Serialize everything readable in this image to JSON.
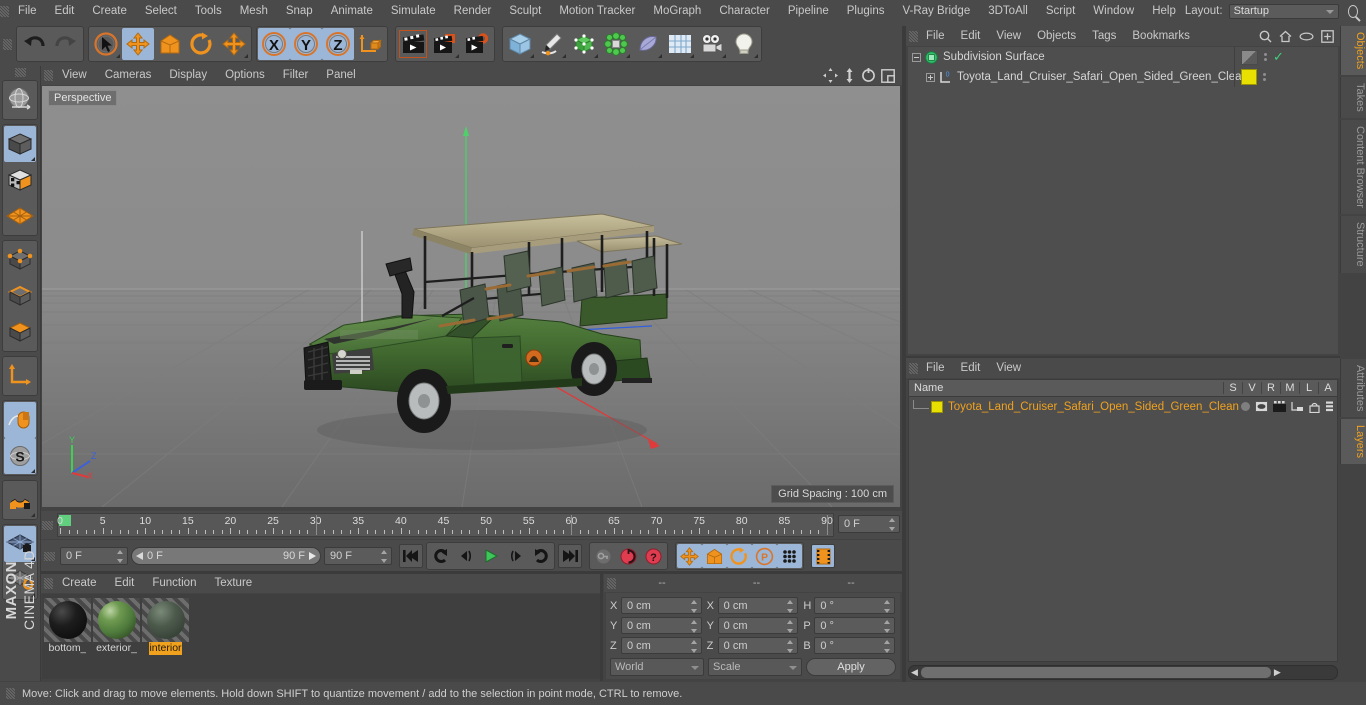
{
  "app": {
    "title": "MAXON CINEMA 4D",
    "brand_line1": "MAXON",
    "brand_line2": "CINEMA 4D"
  },
  "top_menu": {
    "items": [
      "File",
      "Edit",
      "Create",
      "Select",
      "Tools",
      "Mesh",
      "Snap",
      "Animate",
      "Simulate",
      "Render",
      "Sculpt",
      "Motion Tracker",
      "MoGraph",
      "Character",
      "Pipeline",
      "Plugins",
      "V-Ray Bridge",
      "3DToAll",
      "Script",
      "Window",
      "Help"
    ],
    "layout_label": "Layout:",
    "layout_value": "Startup",
    "search_icon": "search-icon"
  },
  "toolbar": {
    "groups": [
      {
        "name": "history",
        "buttons": [
          {
            "name": "undo-button",
            "icon": "undo-arrow-icon",
            "active": false,
            "enabled": true
          },
          {
            "name": "redo-button",
            "icon": "redo-arrow-icon",
            "active": false,
            "enabled": false
          }
        ]
      },
      {
        "name": "transform-tools",
        "buttons": [
          {
            "name": "live-selection-tool",
            "icon": "cursor-circle-icon",
            "active": false,
            "corner": true
          },
          {
            "name": "move-tool",
            "icon": "move-cross-icon",
            "active": true
          },
          {
            "name": "scale-tool",
            "icon": "scale-box-icon",
            "active": false
          },
          {
            "name": "rotate-tool",
            "icon": "rotate-circle-icon",
            "active": false
          },
          {
            "name": "free-move-tool",
            "icon": "move-cross-icon",
            "active": false,
            "corner": true
          }
        ]
      },
      {
        "name": "axis-locks",
        "buttons": [
          {
            "name": "lock-x-axis-button",
            "icon": "x-axis-icon",
            "label": "X",
            "active": true
          },
          {
            "name": "lock-y-axis-button",
            "icon": "y-axis-icon",
            "label": "Y",
            "active": true
          },
          {
            "name": "lock-z-axis-button",
            "icon": "z-axis-icon",
            "label": "Z",
            "active": true
          },
          {
            "name": "world-object-coordinate-button",
            "icon": "world-axis-cube-icon",
            "active": false
          }
        ]
      },
      {
        "name": "render-tools",
        "buttons": [
          {
            "name": "render-view-button",
            "icon": "clapper-icon",
            "active": false,
            "selected_outline": true
          },
          {
            "name": "render-to-picture-viewer-button",
            "icon": "clapper-picture-icon",
            "active": false,
            "corner": true
          },
          {
            "name": "render-settings-button",
            "icon": "clapper-gear-icon",
            "active": false
          }
        ]
      },
      {
        "name": "create-objects",
        "buttons": [
          {
            "name": "add-cube-button",
            "icon": "cube-icon",
            "active": false,
            "corner": true
          },
          {
            "name": "add-spline-button",
            "icon": "pen-spline-icon",
            "active": false,
            "corner": true
          },
          {
            "name": "add-generator-button",
            "icon": "green-cube-generator-icon",
            "active": false,
            "corner": true
          },
          {
            "name": "add-mograph-button",
            "icon": "cloner-icon",
            "active": false,
            "corner": true
          },
          {
            "name": "add-deformer-button",
            "icon": "bend-deformer-icon",
            "active": false,
            "corner": true
          },
          {
            "name": "add-scene-object-button",
            "icon": "floor-grid-icon",
            "active": false,
            "corner": true
          },
          {
            "name": "add-camera-button",
            "icon": "camera-icon",
            "active": false,
            "corner": true
          },
          {
            "name": "add-light-button",
            "icon": "light-bulb-icon",
            "active": false,
            "corner": true
          }
        ]
      }
    ]
  },
  "left_toolbar": {
    "buttons": [
      {
        "name": "viewport-navigation-button",
        "icon": "globe-wire-icon",
        "active": false
      },
      {
        "name": "model-mode-button",
        "icon": "model-cube-icon",
        "active": true,
        "corner": true
      },
      {
        "name": "texture-mode-button",
        "icon": "texture-cube-icon",
        "active": false
      },
      {
        "name": "workplane-mode-button",
        "icon": "workplane-grid-icon",
        "active": false
      },
      {
        "name": "point-mode-button",
        "icon": "points-cube-icon",
        "active": false
      },
      {
        "name": "edge-mode-button",
        "icon": "edges-cube-icon",
        "active": false
      },
      {
        "name": "polygon-mode-button",
        "icon": "polygon-cube-icon",
        "active": false
      },
      {
        "name": "object-axis-mode-button",
        "icon": "axis-L-icon",
        "active": false
      },
      {
        "name": "viewport-solo-button",
        "icon": "mouse-icon",
        "active": true
      },
      {
        "name": "enable-axis-modification-button",
        "icon": "s-sphere-icon",
        "active": true,
        "corner": true
      },
      {
        "name": "snapping-button",
        "icon": "magnet-icon",
        "active": false,
        "corner": true
      },
      {
        "name": "workplane-lock-button",
        "icon": "grid-lock-icon",
        "active": true,
        "corner": true
      },
      {
        "name": "planar-workplane-button",
        "icon": "grid-rotate-icon",
        "active": false,
        "corner": true
      }
    ]
  },
  "viewport": {
    "menu": [
      "View",
      "Cameras",
      "Display",
      "Options",
      "Filter",
      "Panel"
    ],
    "view_label": "Perspective",
    "grid_spacing": "Grid Spacing : 100 cm",
    "panel_icons": [
      "move-view-icon",
      "pan-view-icon",
      "rotate-view-icon",
      "maximize-view-icon"
    ],
    "axis_gizmo": {
      "x": "X",
      "y": "Y",
      "z": "Z"
    }
  },
  "timeline": {
    "ticks": [
      "0",
      "5",
      "10",
      "15",
      "20",
      "25",
      "30",
      "35",
      "40",
      "45",
      "50",
      "55",
      "60",
      "65",
      "70",
      "75",
      "80",
      "85",
      "90"
    ],
    "end_field": "0 F",
    "current_frame_field": "0 F",
    "range_start": "0 F",
    "range_end": "90 F",
    "preview_end_field": "90 F",
    "transport": [
      {
        "name": "go-to-start-button",
        "icon": "skip-start-icon"
      },
      {
        "name": "play-backwards-button",
        "icon": "loop-back-icon"
      },
      {
        "name": "previous-frame-button",
        "icon": "step-back-icon"
      },
      {
        "name": "play-button",
        "icon": "play-icon",
        "accent": "#3ec759"
      },
      {
        "name": "next-frame-button",
        "icon": "step-forward-icon"
      },
      {
        "name": "play-forwards-button",
        "icon": "loop-forward-icon"
      },
      {
        "name": "go-to-end-button",
        "icon": "skip-end-icon"
      },
      {
        "name": "record-active-objects-button",
        "icon": "key-icon"
      },
      {
        "name": "autokeying-button",
        "icon": "record-red-icon",
        "accent": "#e03c50"
      },
      {
        "name": "keyframe-selection-button",
        "icon": "question-red-icon",
        "accent": "#e03c50"
      },
      {
        "name": "position-key-button",
        "icon": "move-cross-icon",
        "active": true
      },
      {
        "name": "scale-key-button",
        "icon": "scale-box-icon",
        "active": true
      },
      {
        "name": "rotation-key-button",
        "icon": "rotate-circle-icon",
        "active": true
      },
      {
        "name": "parameter-key-button",
        "icon": "p-circle-icon",
        "active": true
      },
      {
        "name": "point-level-animation-button",
        "icon": "pla-dots-icon",
        "active": true
      },
      {
        "name": "keyframe-preset-button",
        "icon": "filmstrip-icon",
        "active": true
      }
    ]
  },
  "material_manager": {
    "menu": [
      "Create",
      "Edit",
      "Function",
      "Texture"
    ],
    "materials": [
      {
        "name": "bottom_",
        "color": "#161616",
        "selected": false
      },
      {
        "name": "exterior_",
        "color": "#568046",
        "selected": false
      },
      {
        "name": "interior",
        "color": "#49564c",
        "selected": true
      }
    ]
  },
  "coordinate_manager": {
    "headers": [
      "--",
      "--",
      "--"
    ],
    "rows": [
      {
        "pos_label": "X",
        "pos_value": "0 cm",
        "size_label": "X",
        "size_value": "0 cm",
        "rot_label": "H",
        "rot_value": "0 °"
      },
      {
        "pos_label": "Y",
        "pos_value": "0 cm",
        "size_label": "Y",
        "size_value": "0 cm",
        "rot_label": "P",
        "rot_value": "0 °"
      },
      {
        "pos_label": "Z",
        "pos_value": "0 cm",
        "size_label": "Z",
        "size_value": "0 cm",
        "rot_label": "B",
        "rot_value": "0 °"
      }
    ],
    "system_select": "World",
    "mode_select": "Scale",
    "apply_label": "Apply"
  },
  "object_manager": {
    "menu": [
      "File",
      "Edit",
      "View",
      "Objects",
      "Tags",
      "Bookmarks"
    ],
    "right_icons": [
      "search-icon",
      "home-icon",
      "eye-icon",
      "add-layer-icon"
    ],
    "rows": [
      {
        "name": "Subdivision Surface",
        "icon": "subdivision-surface-icon",
        "indent": 0,
        "tag_color": "#8a8a8a",
        "has_check": true,
        "expanded": true
      },
      {
        "name": "Toyota_Land_Cruiser_Safari_Open_Sided_Green_Clean",
        "icon": "polygon-object-icon",
        "indent": 1,
        "tag_color": "#e8e000",
        "has_check": false,
        "expanded": false
      }
    ]
  },
  "layer_manager": {
    "menu": [
      "File",
      "Edit",
      "View"
    ],
    "columns": [
      "Name",
      "S",
      "V",
      "R",
      "M",
      "L",
      "A"
    ],
    "rows": [
      {
        "name": "Toyota_Land_Cruiser_Safari_Open_Sided_Green_Clean",
        "color": "#e8e000"
      }
    ]
  },
  "right_tabs": {
    "upper": [
      {
        "label": "Objects",
        "active": true
      },
      {
        "label": "Takes",
        "active": false
      },
      {
        "label": "Content Browser",
        "active": false
      },
      {
        "label": "Structure",
        "active": false
      }
    ],
    "lower": [
      {
        "label": "Attributes",
        "active": false
      },
      {
        "label": "Layers",
        "active": true
      }
    ]
  },
  "status_bar": {
    "text": "Move: Click and drag to move elements. Hold down SHIFT to quantize movement / add to the selection in point mode, CTRL to remove."
  },
  "colors": {
    "panel_bg": "#434343",
    "chrome": "#4a4a4a",
    "accent_orange": "#f0a11e",
    "active_blue": "#9bb6d6",
    "text": "#c8c8c8"
  }
}
